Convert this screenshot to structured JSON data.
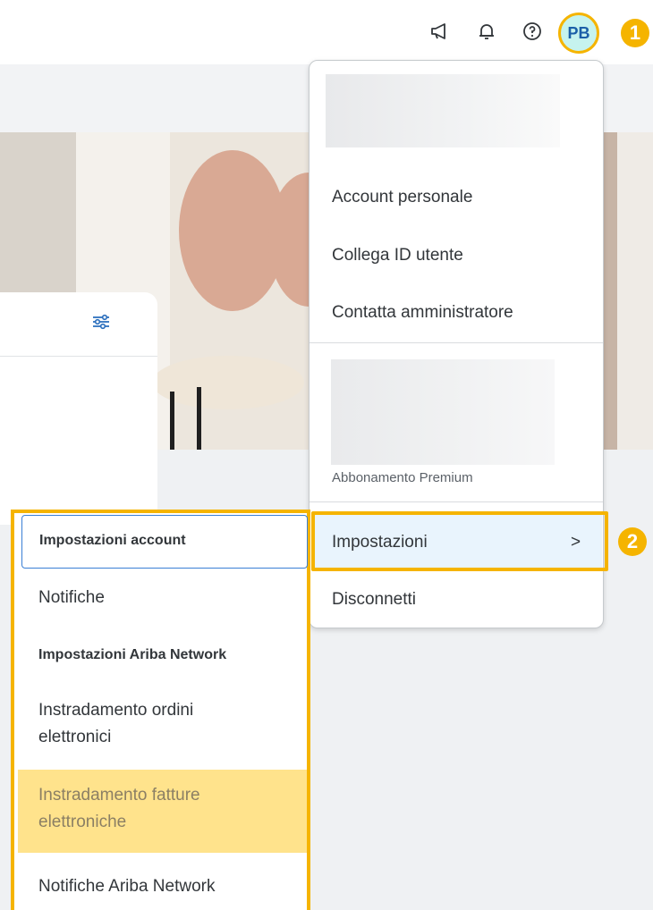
{
  "topbar": {
    "announce_icon": "megaphone-icon",
    "bell_icon": "bell-icon",
    "help_icon": "help-icon",
    "avatar_initials": "PB",
    "badge_1": "1",
    "badge_2": "2"
  },
  "user_menu": {
    "items": [
      "Account personale",
      "Collega ID utente",
      "Contatta amministratore"
    ],
    "premium_label": "Abbonamento Premium",
    "settings_label": "Impostazioni",
    "settings_chevron": ">",
    "logout_label": "Disconnetti"
  },
  "settings_submenu": {
    "account_heading": "Impostazioni account",
    "notifications": "Notifiche",
    "network_heading": "Impostazioni Ariba Network",
    "order_routing_line1": "Instradamento ordini",
    "order_routing_line2": "elettronici",
    "invoice_routing_line1": "Instradamento fatture",
    "invoice_routing_line2": "elettroniche",
    "network_notifications": "Notifiche Ariba Network"
  },
  "colors": {
    "highlight": "#f5b400",
    "avatar_bg": "#c6f3ee",
    "selected_row": "#ffe38c"
  }
}
